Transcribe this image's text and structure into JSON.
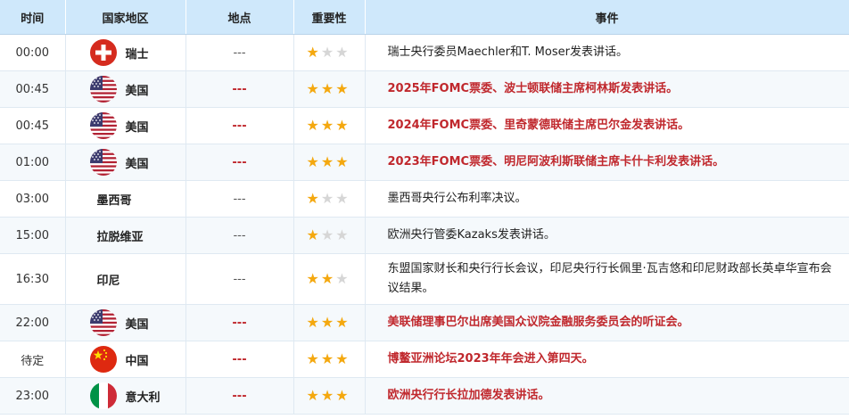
{
  "headers": {
    "time": "时间",
    "country": "国家地区",
    "location": "地点",
    "importance": "重要性",
    "event": "事件"
  },
  "colors": {
    "header_bg": "#cfe8fb",
    "highlight_text": "#c0282d",
    "star_on": "#f4a80f",
    "star_off": "#d6d6d6"
  },
  "rows": [
    {
      "time": "00:00",
      "flag": "switzerland-flag-icon",
      "country": "瑞士",
      "location": "---",
      "stars": 1,
      "high": false,
      "event": "瑞士央行委员Maechler和T. Moser发表讲话。"
    },
    {
      "time": "00:45",
      "flag": "usa-flag-icon",
      "country": "美国",
      "location": "---",
      "stars": 3,
      "high": true,
      "event": "2025年FOMC票委、波士顿联储主席柯林斯发表讲话。"
    },
    {
      "time": "00:45",
      "flag": "usa-flag-icon",
      "country": "美国",
      "location": "---",
      "stars": 3,
      "high": true,
      "event": "2024年FOMC票委、里奇蒙德联储主席巴尔金发表讲话。"
    },
    {
      "time": "01:00",
      "flag": "usa-flag-icon",
      "country": "美国",
      "location": "---",
      "stars": 3,
      "high": true,
      "event": "2023年FOMC票委、明尼阿波利斯联储主席卡什卡利发表讲话。"
    },
    {
      "time": "03:00",
      "flag": "",
      "country": "墨西哥",
      "location": "---",
      "stars": 1,
      "high": false,
      "event": "墨西哥央行公布利率决议。"
    },
    {
      "time": "15:00",
      "flag": "",
      "country": "拉脱维亚",
      "location": "---",
      "stars": 1,
      "high": false,
      "event": "欧洲央行管委Kazaks发表讲话。"
    },
    {
      "time": "16:30",
      "flag": "",
      "country": "印尼",
      "location": "---",
      "stars": 2,
      "high": false,
      "event": "东盟国家财长和央行行长会议，印尼央行行长佩里·瓦吉悠和印尼财政部长英卓华宣布会议结果。"
    },
    {
      "time": "22:00",
      "flag": "usa-flag-icon",
      "country": "美国",
      "location": "---",
      "stars": 3,
      "high": true,
      "event": "美联储理事巴尔出席美国众议院金融服务委员会的听证会。"
    },
    {
      "time": "待定",
      "flag": "china-flag-icon",
      "country": "中国",
      "location": "---",
      "stars": 3,
      "high": true,
      "event": "博鳌亚洲论坛2023年年会进入第四天。"
    },
    {
      "time": "23:00",
      "flag": "italy-flag-icon",
      "country": "意大利",
      "location": "---",
      "stars": 3,
      "high": true,
      "event": "欧洲央行行长拉加德发表讲话。"
    }
  ]
}
